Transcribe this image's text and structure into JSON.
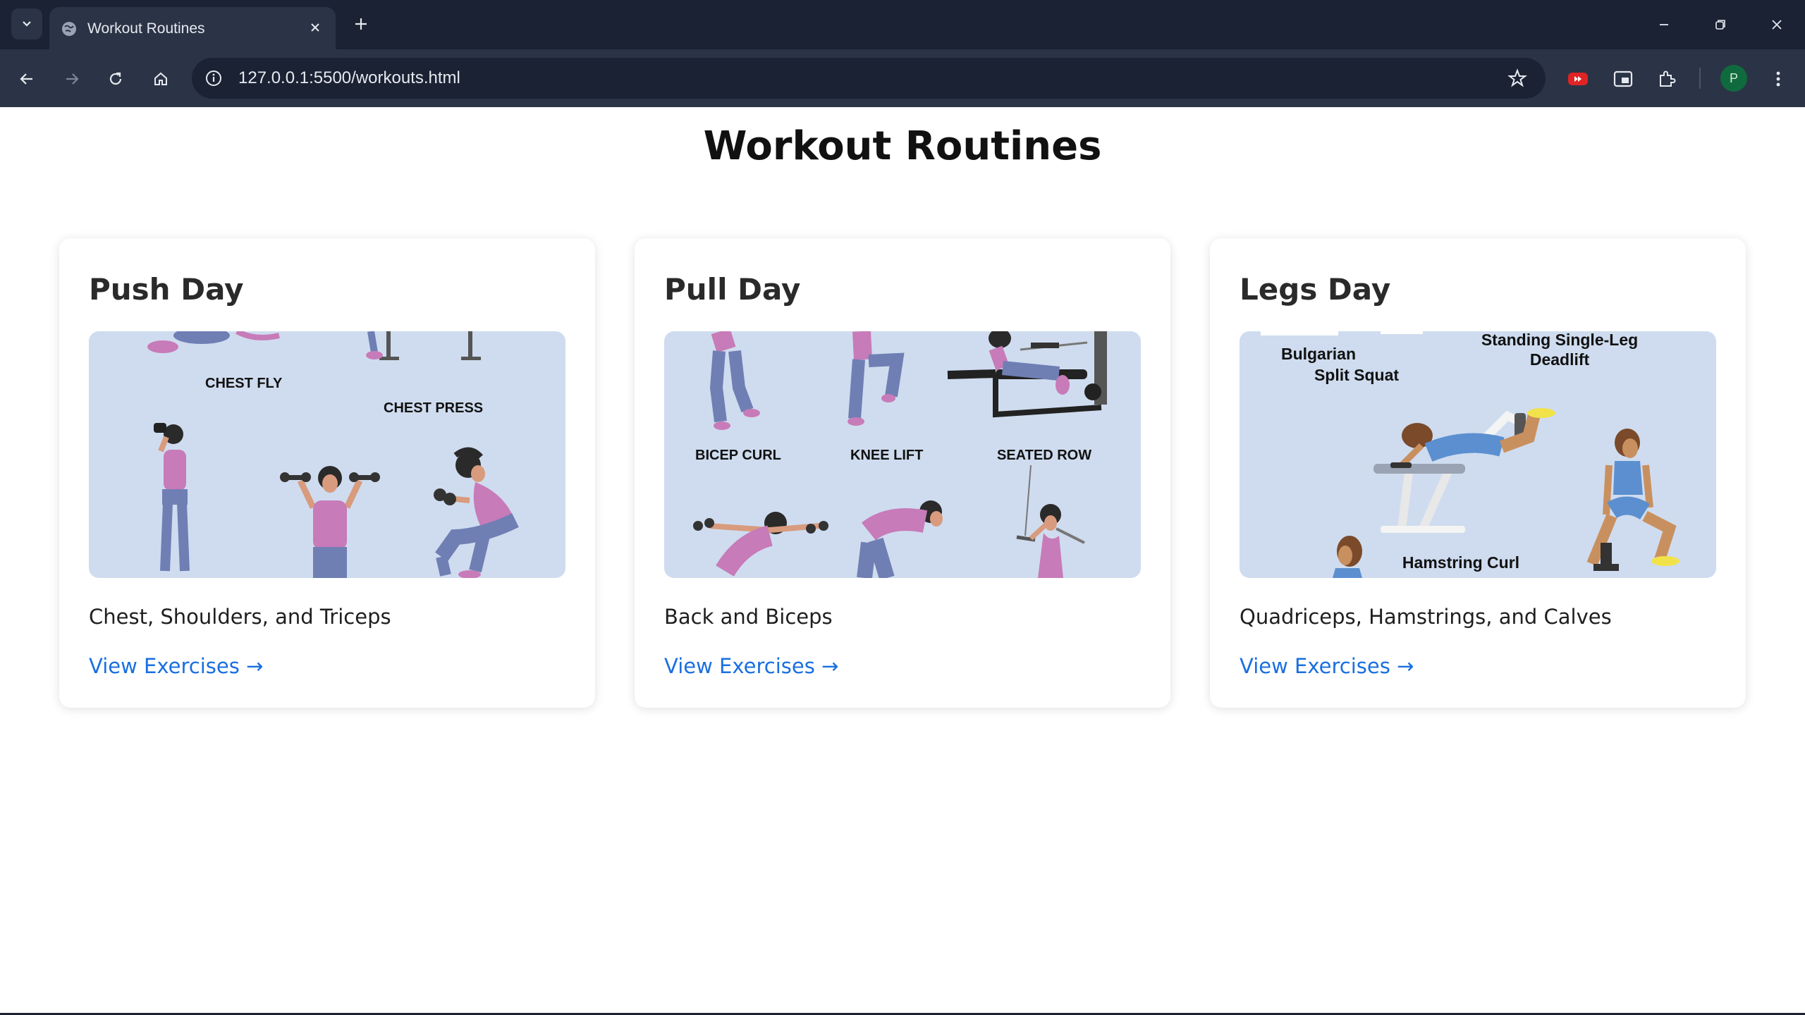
{
  "browser": {
    "tab_title": "Workout Routines",
    "url": "127.0.0.1:5500/workouts.html",
    "profile_initial": "P"
  },
  "page": {
    "title": "Workout Routines",
    "cards": [
      {
        "title": "Push Day",
        "description": "Chest, Shoulders, and Triceps",
        "link": "View Exercises →",
        "image_labels": [
          "CHEST FLY",
          "CHEST PRESS"
        ]
      },
      {
        "title": "Pull Day",
        "description": "Back and Biceps",
        "link": "View Exercises →",
        "image_labels": [
          "BICEP CURL",
          "KNEE LIFT",
          "SEATED ROW"
        ]
      },
      {
        "title": "Legs Day",
        "description": "Quadriceps, Hamstrings, and Calves",
        "link": "View Exercises →",
        "image_labels": [
          "Bulgarian",
          "Split Squat",
          "Standing Single-Leg",
          "Deadlift",
          "Hamstring Curl"
        ]
      }
    ]
  },
  "colors": {
    "accent_link": "#1a6fe0",
    "image_bg": "#cfdcef",
    "figure_top": "#c77bb8",
    "figure_legs": "#6f7fb4",
    "legs_top": "#5b8fd0"
  }
}
